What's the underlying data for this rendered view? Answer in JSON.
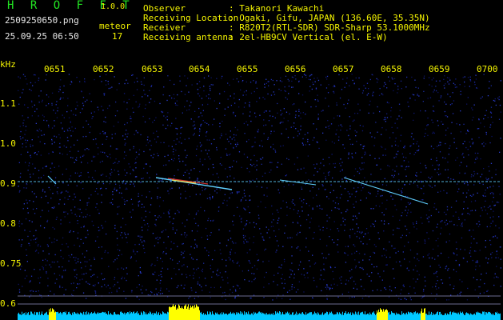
{
  "header": {
    "app_title": "H R O F F T",
    "app_version": "1.0.0",
    "file_name": "2509250650.png",
    "meteor_label": "meteor",
    "timestamp": "25.09.25 06:50",
    "meteor_count": "17"
  },
  "info": [
    {
      "key": "Observer",
      "value": ": Takanori Kawachi"
    },
    {
      "key": "Receiving Location",
      "value": ": Ogaki, Gifu, JAPAN (136.60E, 35.35N)"
    },
    {
      "key": "Receiver",
      "value": ": R820T2(RTL-SDR) SDR-Sharp 53.1000MHz"
    },
    {
      "key": "Receiving antenna",
      "value": ": 2el-HB9CV Vertical (el. E-W)"
    }
  ],
  "axes": {
    "freq_unit": "kHz",
    "time_ticks": [
      "0651",
      "0652",
      "0653",
      "0654",
      "0655",
      "0656",
      "0657",
      "0658",
      "0659",
      "0700"
    ],
    "freq_ticks": [
      "1.1",
      "1.0",
      "0.9",
      "0.8",
      "0.75",
      "0.6"
    ]
  },
  "colors": {
    "background": "#000000",
    "text_green": "#22e422",
    "text_yellow": "#f4f400",
    "trace": "#60d0ff",
    "noise": "#1a2a9a",
    "level_bar": "#00c8ff",
    "peak": "#ffff00"
  }
}
